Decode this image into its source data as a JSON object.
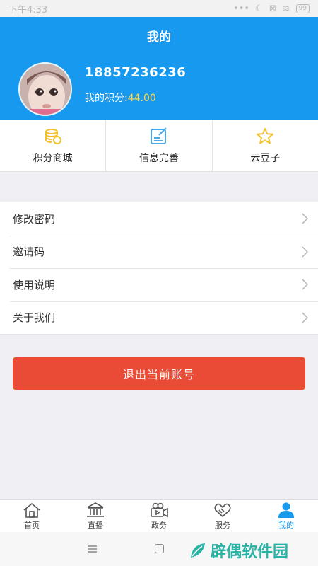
{
  "status_bar": {
    "time": "下午4:33",
    "battery": "99"
  },
  "header": {
    "title": "我的"
  },
  "profile": {
    "phone": "18857236236",
    "points_label": "我的积分:",
    "points_value": "44.00"
  },
  "quick_actions": [
    {
      "label": "积分商城",
      "icon": "coins-icon"
    },
    {
      "label": "信息完善",
      "icon": "edit-form-icon"
    },
    {
      "label": "云豆子",
      "icon": "star-icon"
    }
  ],
  "menu": [
    {
      "label": "修改密码"
    },
    {
      "label": "邀请码"
    },
    {
      "label": "使用说明"
    },
    {
      "label": "关于我们"
    }
  ],
  "logout": {
    "label": "退出当前账号"
  },
  "tabs": [
    {
      "label": "首页",
      "icon": "home-icon"
    },
    {
      "label": "直播",
      "icon": "building-icon"
    },
    {
      "label": "政务",
      "icon": "video-camera-icon"
    },
    {
      "label": "服务",
      "icon": "handshake-icon"
    },
    {
      "label": "我的",
      "icon": "person-icon",
      "active": true
    }
  ],
  "watermark": {
    "text": "辟偶软件园"
  },
  "colors": {
    "primary": "#1699ef",
    "logout": "#e94b36",
    "points": "#ffd84a",
    "icon_gold": "#f2c230",
    "icon_blue": "#4aa8e8"
  }
}
